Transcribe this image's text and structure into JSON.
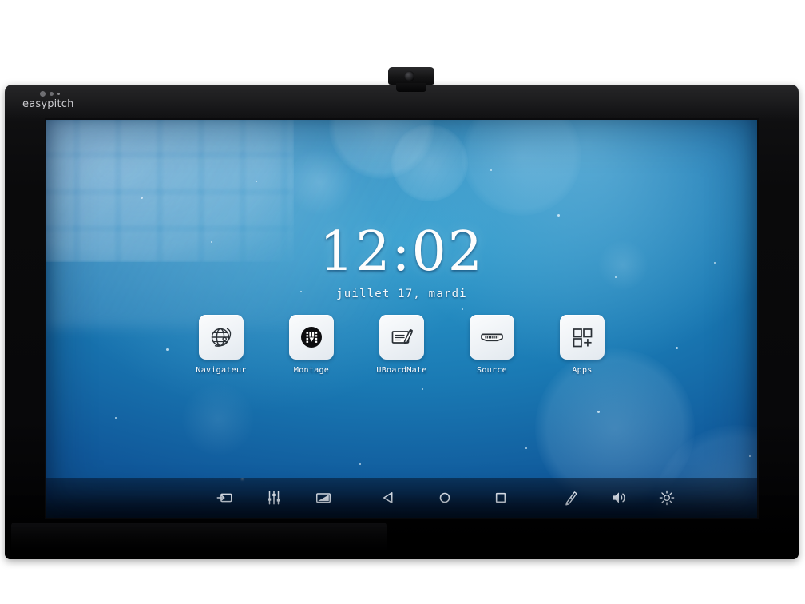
{
  "device": {
    "brand": "easypitch",
    "type": "interactive-flat-panel-display",
    "accessory": "webcam"
  },
  "screen": {
    "clock": {
      "time": "12:02",
      "date": "juillet 17, mardi"
    },
    "wallpaper": {
      "style": "blue bokeh gradient",
      "color_top": "#2e9ccd",
      "color_bottom": "#0a3c74"
    },
    "apps": [
      {
        "label": "Navigateur",
        "icon": "globe-icon"
      },
      {
        "label": "Montage",
        "icon": "film-circle-icon"
      },
      {
        "label": "UBoardMate",
        "icon": "note-pen-icon"
      },
      {
        "label": "Source",
        "icon": "hdmi-port-icon"
      },
      {
        "label": "Apps",
        "icon": "app-grid-plus-icon"
      }
    ],
    "sysbar": {
      "left": [
        {
          "name": "input-source-icon",
          "tooltip": "Source"
        },
        {
          "name": "equalizer-sliders-icon",
          "tooltip": "Audio"
        },
        {
          "name": "picture-mode-icon",
          "tooltip": "Image"
        }
      ],
      "nav": [
        {
          "name": "back-triangle-icon",
          "tooltip": "Retour"
        },
        {
          "name": "home-circle-icon",
          "tooltip": "Accueil"
        },
        {
          "name": "recents-square-icon",
          "tooltip": "Applications récentes"
        }
      ],
      "right": [
        {
          "name": "pencil-annotate-icon",
          "tooltip": "Annoter"
        },
        {
          "name": "volume-speaker-icon",
          "tooltip": "Volume"
        },
        {
          "name": "brightness-sun-icon",
          "tooltip": "Luminosité"
        }
      ]
    }
  }
}
